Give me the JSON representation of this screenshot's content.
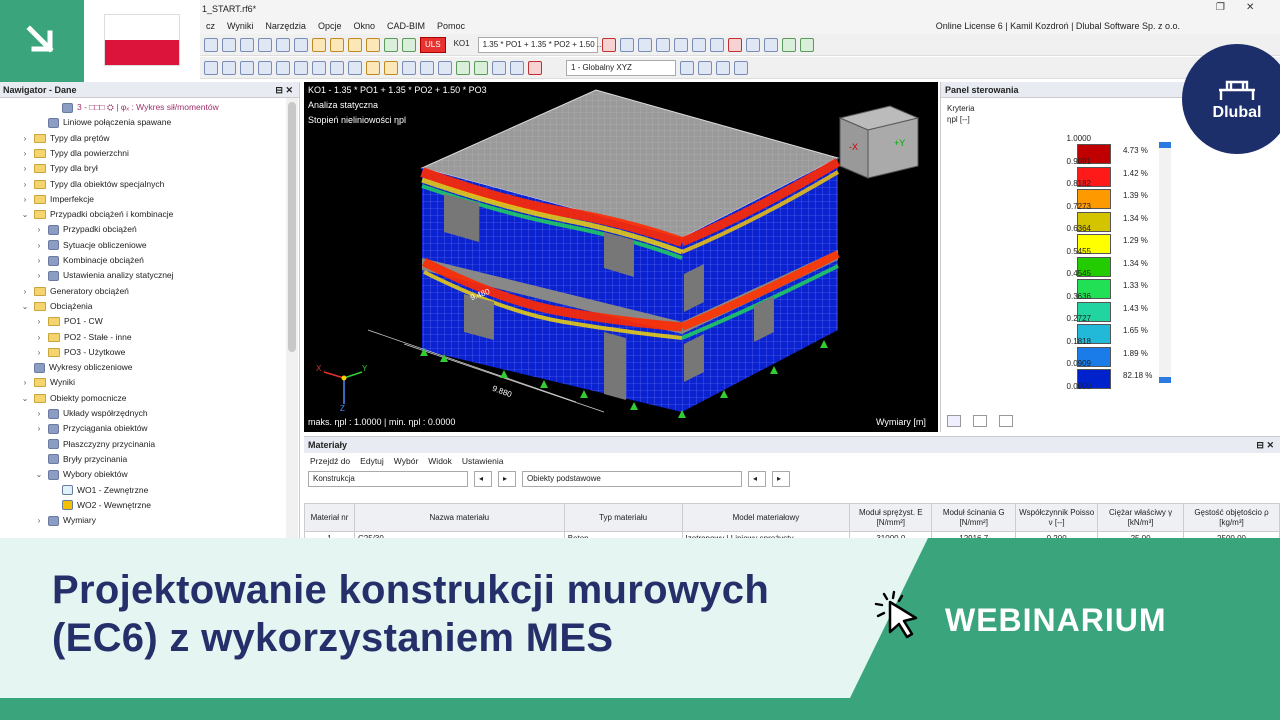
{
  "app": {
    "title": "1_START.rf6*",
    "license": "Online License 6 | Kamil Kozdroń | Dlubal Software Sp. z o.o.",
    "menu": [
      "Wyniki",
      "Narzędzia",
      "Opcje",
      "Okno",
      "CAD-BIM",
      "Pomoc"
    ],
    "menu_prefix": "cz"
  },
  "toolbar": {
    "uls_badge": "ULS",
    "combo_label": "KO1",
    "combo_value": "1.35 * PO1 + 1.35 * PO2 + 1.50 ...",
    "coord_system": "1 - Globalny XYZ"
  },
  "navigator": {
    "title": "Nawigator - Dane",
    "items": [
      {
        "label": "3 - □□□ ⛭ | φₓ : Wykres sił/momentów",
        "indent": 3,
        "icon": "diagram-icon",
        "twist": ""
      },
      {
        "label": "Liniowe połączenia spawane",
        "indent": 2,
        "icon": "weld-icon",
        "twist": ""
      },
      {
        "label": "Typy dla prętów",
        "indent": 1,
        "icon": "folder",
        "twist": "›"
      },
      {
        "label": "Typy dla powierzchni",
        "indent": 1,
        "icon": "folder",
        "twist": "›"
      },
      {
        "label": "Typy dla brył",
        "indent": 1,
        "icon": "folder",
        "twist": "›"
      },
      {
        "label": "Typy dla obiektów specjalnych",
        "indent": 1,
        "icon": "folder",
        "twist": "›"
      },
      {
        "label": "Imperfekcje",
        "indent": 1,
        "icon": "folder",
        "twist": "›"
      },
      {
        "label": "Przypadki obciążeń i kombinacje",
        "indent": 1,
        "icon": "folder",
        "twist": "⌄"
      },
      {
        "label": "Przypadki obciążeń",
        "indent": 2,
        "icon": "loadcase-icon",
        "twist": "›"
      },
      {
        "label": "Sytuacje obliczeniowe",
        "indent": 2,
        "icon": "situation-icon",
        "twist": "›"
      },
      {
        "label": "Kombinacje obciążeń",
        "indent": 2,
        "icon": "combination-icon",
        "twist": "›"
      },
      {
        "label": "Ustawienia analizy statycznej",
        "indent": 2,
        "icon": "analysis-icon",
        "twist": "›"
      },
      {
        "label": "Generatory obciążeń",
        "indent": 1,
        "icon": "folder",
        "twist": "›"
      },
      {
        "label": "Obciążenia",
        "indent": 1,
        "icon": "folder",
        "twist": "⌄"
      },
      {
        "label": "PO1 - CW",
        "indent": 2,
        "icon": "folder",
        "twist": "›"
      },
      {
        "label": "PO2 - Stałe - inne",
        "indent": 2,
        "icon": "folder",
        "twist": "›"
      },
      {
        "label": "PO3 - Użytkowe",
        "indent": 2,
        "icon": "folder",
        "twist": "›"
      },
      {
        "label": "Wykresy obliczeniowe",
        "indent": 1,
        "icon": "chart-icon",
        "twist": ""
      },
      {
        "label": "Wyniki",
        "indent": 1,
        "icon": "folder",
        "twist": "›"
      },
      {
        "label": "Obiekty pomocnicze",
        "indent": 1,
        "icon": "folder",
        "twist": "⌄"
      },
      {
        "label": "Układy współrzędnych",
        "indent": 2,
        "icon": "axes-icon",
        "twist": "›"
      },
      {
        "label": "Przyciągania obiektów",
        "indent": 2,
        "icon": "magnet-icon",
        "twist": "›"
      },
      {
        "label": "Płaszczyzny przycinania",
        "indent": 2,
        "icon": "plane-icon",
        "twist": ""
      },
      {
        "label": "Bryły przycinania",
        "indent": 2,
        "icon": "box-icon",
        "twist": ""
      },
      {
        "label": "Wybory obiektów",
        "indent": 2,
        "icon": "selection-icon",
        "twist": "⌄"
      },
      {
        "label": "WO1 - Zewnętrzne",
        "indent": 3,
        "icon": "swatch-light",
        "twist": ""
      },
      {
        "label": "WO2 - Wewnętrzne",
        "indent": 3,
        "icon": "swatch-yellow",
        "twist": ""
      },
      {
        "label": "Wymiary",
        "indent": 2,
        "icon": "dimension-icon",
        "twist": "›"
      }
    ]
  },
  "viewport": {
    "line1": "KO1 - 1.35 * PO1 + 1.35 * PO2 + 1.50 * PO3",
    "line2": "Analiza statyczna",
    "line3": "Stopień nieliniowości ηpl",
    "footer": "maks. ηpl : 1.0000 | min. ηpl : 0.0000",
    "units": "Wymiary [m]",
    "dim1": "9.880",
    "dim2": "9.480",
    "nav_x": "-X",
    "nav_y": "+Y",
    "axis_z": "Z",
    "axis_x": "X",
    "axis_y": "Y"
  },
  "panel": {
    "title": "Panel sterowania",
    "criterion_label": "Kryteria",
    "criterion_value": "ηpl [--]",
    "legend": [
      {
        "value": "1.0000",
        "color": "#c00000",
        "pct": "4.73 %"
      },
      {
        "value": "0.9091",
        "color": "#ff1a1a",
        "pct": "1.42 %"
      },
      {
        "value": "0.8182",
        "color": "#ff9900",
        "pct": "1.39 %"
      },
      {
        "value": "0.7273",
        "color": "#d4c400",
        "pct": "1.34 %"
      },
      {
        "value": "0.6364",
        "color": "#ffff00",
        "pct": "1.29 %"
      },
      {
        "value": "0.5455",
        "color": "#22cc00",
        "pct": "1.34 %"
      },
      {
        "value": "0.4545",
        "color": "#22e055",
        "pct": "1.33 %"
      },
      {
        "value": "0.3636",
        "color": "#22d4a0",
        "pct": "1.43 %"
      },
      {
        "value": "0.2727",
        "color": "#22b8d8",
        "pct": "1.65 %"
      },
      {
        "value": "0.1818",
        "color": "#1a7ce8",
        "pct": "1.89 %"
      },
      {
        "value": "0.0909",
        "color": "#0022cc",
        "pct": "82.18 %"
      },
      {
        "value": "0.0000",
        "color": "#000090",
        "pct": ""
      }
    ]
  },
  "materials": {
    "title": "Materiały",
    "menu": [
      "Przejdź do",
      "Edytuj",
      "Wybór",
      "Widok",
      "Ustawienia"
    ],
    "filter1": "Konstrukcja",
    "filter2": "Obiekty podstawowe",
    "headers": [
      "Materiał nr",
      "Nazwa materiału",
      "Typ materiału",
      "Model materiałowy",
      "Moduł sprężyst. E [N/mm²]",
      "Moduł ścinania G [N/mm²]",
      "Współczynnik Poisso ν [--]",
      "Ciężar właściwy γ [kN/m³]",
      "Gęstość objętościo ρ [kg/m³]"
    ],
    "row": [
      "1",
      "C25/30",
      "Beton",
      "Izotropowy | Liniowy sprężysty",
      "31000.0",
      "12916.7",
      "0.200",
      "25.00",
      "2500.00"
    ]
  },
  "banner": {
    "title_line1": "Projektowanie konstrukcji murowych",
    "title_line2": "(EC6) z wykorzystaniem MES",
    "tag": "WEBINARIUM"
  },
  "logo": {
    "text": "Dlubal"
  },
  "colors": {
    "brand_green": "#3aa57c",
    "navy": "#25306a",
    "banner_bg": "#e5f6f2"
  }
}
